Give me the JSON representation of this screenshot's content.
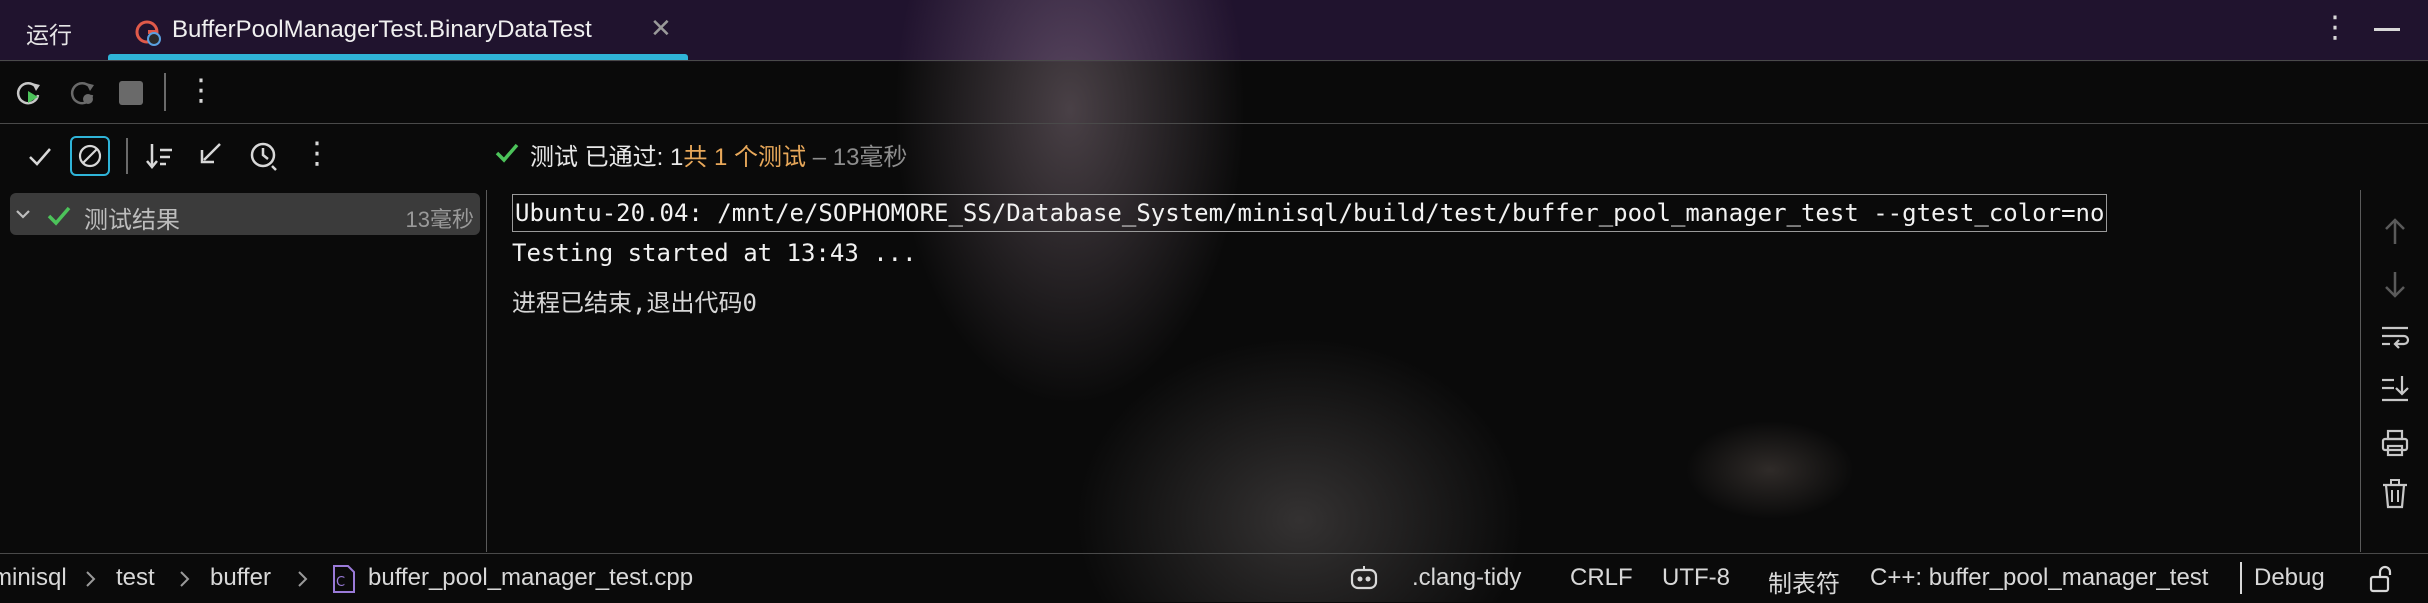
{
  "window": {
    "run_label": "运行",
    "tab_title": "BufferPoolManagerTest.BinaryDataTest",
    "tab_close": "✕",
    "more": "⋮"
  },
  "toolbar": {
    "more": "⋮"
  },
  "test_status": {
    "label": "测试 已通过: 1",
    "count": "共 1 个测试",
    "duration": " – 13毫秒"
  },
  "test_tree": {
    "root_label": "测试结果",
    "root_time": "13毫秒"
  },
  "console": {
    "command": "Ubuntu-20.04: /mnt/e/SOPHOMORE_SS/Database_System/minisql/build/test/buffer_pool_manager_test --gtest_color=no",
    "line2": "Testing started at 13:43 ...",
    "line3": "进程已结束,退出代码0"
  },
  "statusbar": {
    "breadcrumb_1": "minisql",
    "breadcrumb_2": "test",
    "breadcrumb_3": "buffer",
    "breadcrumb_4": "buffer_pool_manager_test.cpp",
    "clang_tidy": ".clang-tidy",
    "line_ending": "CRLF",
    "encoding": "UTF-8",
    "indent": "制表符",
    "context": "C++: buffer_pool_manager_test",
    "config": "Debug"
  },
  "colors": {
    "accent": "#2fb4d8",
    "success": "#4cc35a",
    "count": "#e8a85a"
  }
}
